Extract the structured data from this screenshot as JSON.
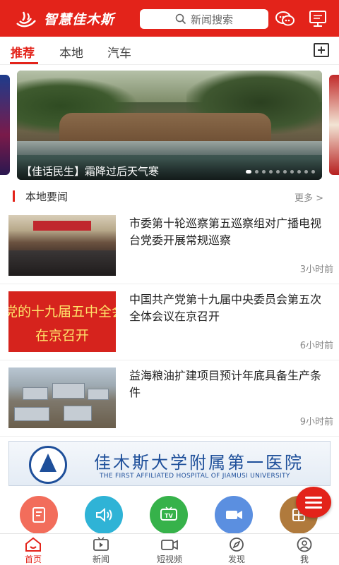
{
  "header": {
    "app_name": "智慧佳木斯",
    "search_placeholder": "新闻搜索",
    "icons": [
      "logo-icon",
      "chat-icon",
      "tv-icon"
    ],
    "brand_color": "#e3231a"
  },
  "tabs": [
    {
      "label": "推荐",
      "active": true
    },
    {
      "label": "本地",
      "active": false
    },
    {
      "label": "汽车",
      "active": false
    }
  ],
  "carousel": {
    "caption": "【佳话民生】霜降过后天气寒",
    "slide_count": 10,
    "active_index": 0
  },
  "section": {
    "title": "本地要闻",
    "more_label": "更多 >"
  },
  "news": [
    {
      "title": "市委第十轮巡察第五巡察组对广播电视台党委开展常规巡察",
      "time": "3小时前"
    },
    {
      "title": "中国共产党第十九届中央委员会第五次全体会议在京召开",
      "time": "6小时前",
      "thumb_line1": "党的十九届五中全会",
      "thumb_line2": "在京召开"
    },
    {
      "title": "益海粮油扩建项目预计年底具备生产条件",
      "time": "9小时前"
    }
  ],
  "ad": {
    "title_cn": "佳木斯大学附属第一医院",
    "title_en": "THE FIRST AFFILIATED HOSPITAL OF JIAMUSI UNIVERSITY"
  },
  "shortcuts": [
    {
      "icon": "document-icon",
      "color": "#f26d5b"
    },
    {
      "icon": "speaker-icon",
      "color": "#2fb3d6"
    },
    {
      "icon": "tv-icon",
      "color": "#36b24a"
    },
    {
      "icon": "video-camera-icon",
      "color": "#5b8fe0"
    },
    {
      "icon": "stamp-icon",
      "color": "#b07a3c"
    }
  ],
  "bottom_nav": [
    {
      "label": "首页",
      "icon": "home-icon",
      "active": true
    },
    {
      "label": "新闻",
      "icon": "news-tv-icon",
      "active": false
    },
    {
      "label": "短视频",
      "icon": "video-icon",
      "active": false
    },
    {
      "label": "发现",
      "icon": "compass-icon",
      "active": false
    },
    {
      "label": "我",
      "icon": "user-icon",
      "active": false
    }
  ]
}
